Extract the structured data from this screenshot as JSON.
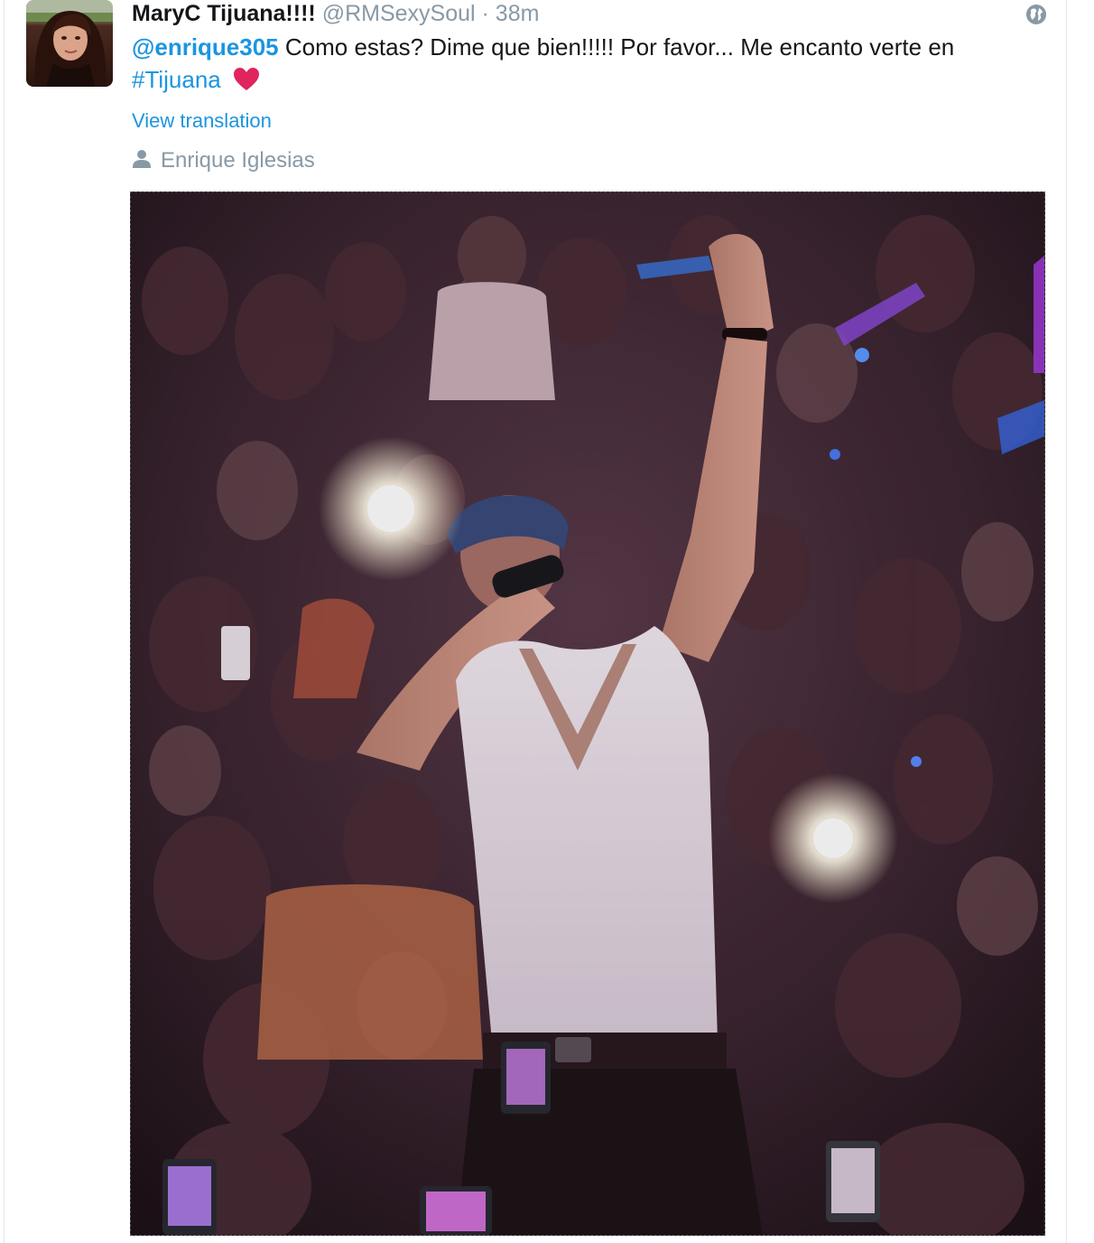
{
  "tweet": {
    "fullname": "MaryC Tijuana!!!!",
    "username": "@RMSexySoul",
    "dot": "·",
    "time": "38m",
    "mention": "@enrique305",
    "text": " Como estas?  Dime que bien!!!!! Por favor... Me encanto verte en ",
    "hashtag": "#Tijuana",
    "view_translation": "View translation",
    "tagged_user": "Enrique Iglesias",
    "icons": {
      "avatar": "avatar",
      "globe": "globe-icon",
      "heart": "heart-icon",
      "user": "user-icon"
    },
    "colors": {
      "link": "#1b95e0",
      "muted": "#8899a6",
      "text": "#14171a",
      "heart": "#e0245e"
    }
  }
}
